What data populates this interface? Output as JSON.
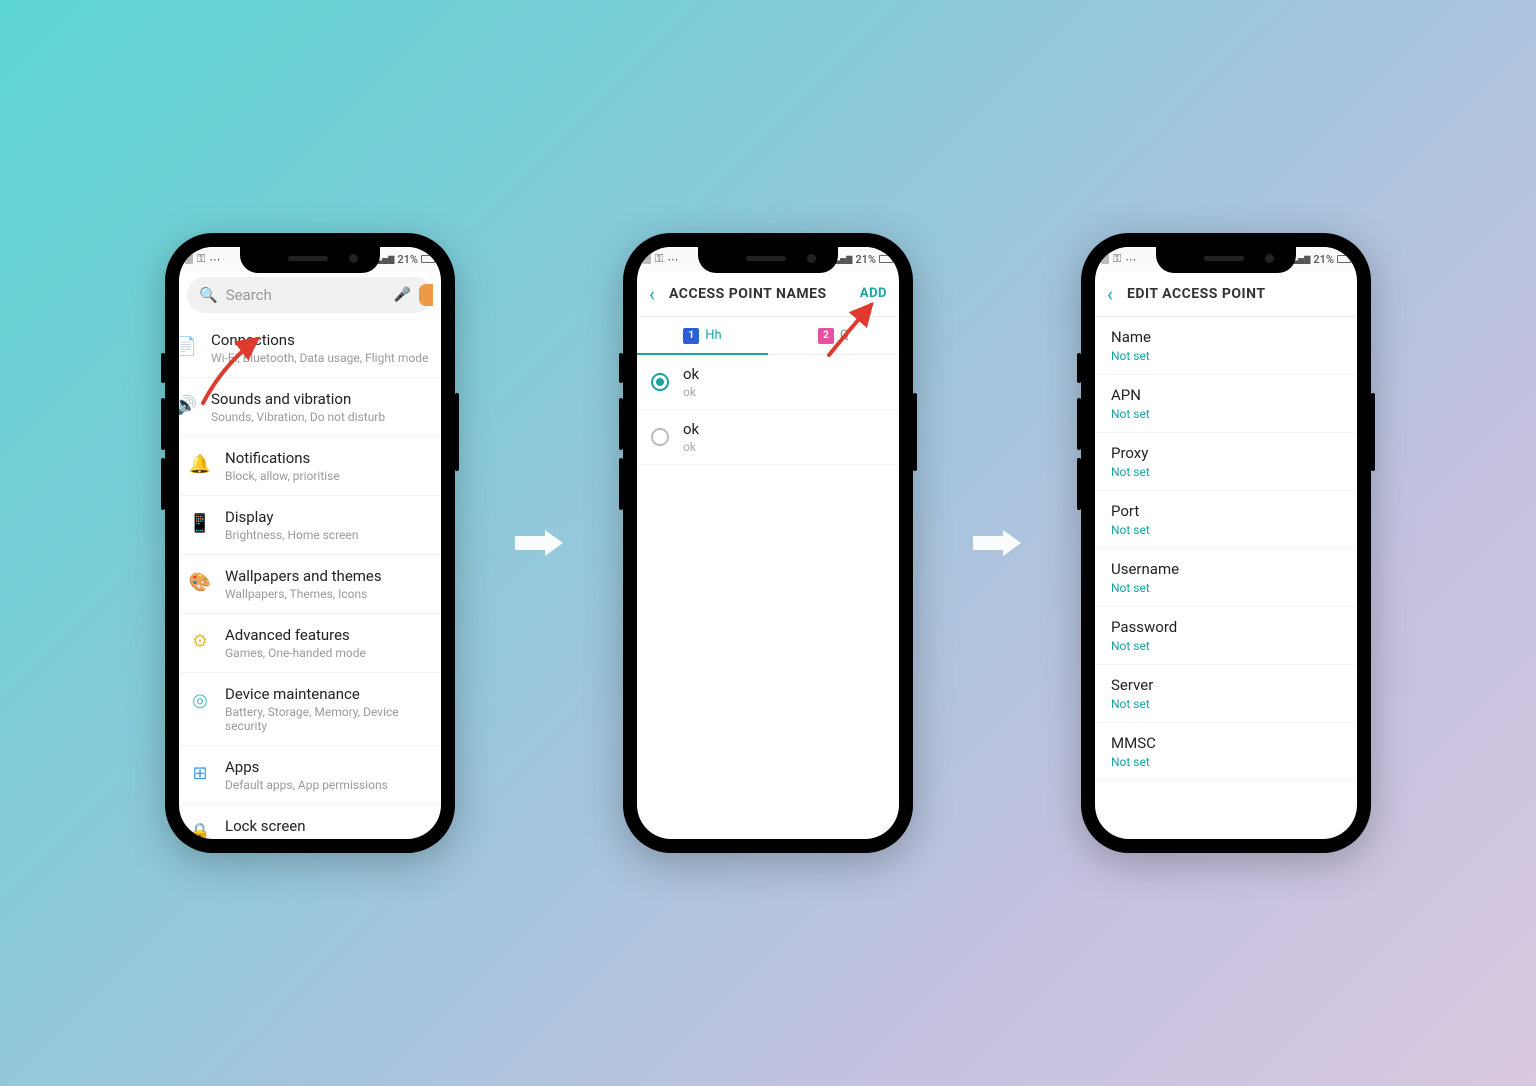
{
  "status": {
    "battery_text": "21%",
    "key_glyph": "⚿",
    "dots_glyph": "⋯",
    "signal_glyph": "▁▃▅▇"
  },
  "phone1": {
    "search_placeholder": "Search",
    "items": [
      {
        "icon": "📄",
        "color": "#4aa0e6",
        "title": "Connections",
        "sub": "Wi-Fi, Bluetooth, Data usage, Flight mode",
        "half": true
      },
      {
        "icon": "🔊",
        "color": "#4aa0e6",
        "title": "Sounds and vibration",
        "sub": "Sounds, Vibration, Do not disturb",
        "half": true
      },
      {
        "icon": "🔔",
        "color": "#e6a24a",
        "title": "Notifications",
        "sub": "Block, allow, prioritise"
      },
      {
        "icon": "📱",
        "color": "#6cc04a",
        "title": "Display",
        "sub": "Brightness, Home screen"
      },
      {
        "icon": "🎨",
        "color": "#b96ad6",
        "title": "Wallpapers and themes",
        "sub": "Wallpapers, Themes, Icons"
      },
      {
        "icon": "⚙",
        "color": "#e6c04a",
        "title": "Advanced features",
        "sub": "Games, One-handed mode"
      },
      {
        "icon": "◎",
        "color": "#4ac0c0",
        "title": "Device maintenance",
        "sub": "Battery, Storage, Memory, Device security"
      },
      {
        "icon": "⊞",
        "color": "#4aa0e6",
        "title": "Apps",
        "sub": "Default apps, App permissions"
      },
      {
        "icon": "🔒",
        "color": "#4aa0e6",
        "title": "Lock screen",
        "sub": ""
      }
    ]
  },
  "phone2": {
    "header_title": "ACCESS POINT NAMES",
    "add_label": "ADD",
    "sim_tabs": [
      {
        "badge": "1",
        "label": "Hh",
        "active": true
      },
      {
        "badge": "2",
        "label": "Q",
        "active": false
      }
    ],
    "apns": [
      {
        "title": "ok",
        "sub": "ok",
        "selected": true
      },
      {
        "title": "ok",
        "sub": "ok",
        "selected": false
      }
    ]
  },
  "phone3": {
    "header_title": "EDIT ACCESS POINT",
    "fields": [
      {
        "label": "Name",
        "value": "Not set"
      },
      {
        "label": "APN",
        "value": "Not set"
      },
      {
        "label": "Proxy",
        "value": "Not set"
      },
      {
        "label": "Port",
        "value": "Not set"
      },
      {
        "label": "Username",
        "value": "Not set"
      },
      {
        "label": "Password",
        "value": "Not set"
      },
      {
        "label": "Server",
        "value": "Not set"
      },
      {
        "label": "MMSC",
        "value": "Not set"
      }
    ]
  }
}
